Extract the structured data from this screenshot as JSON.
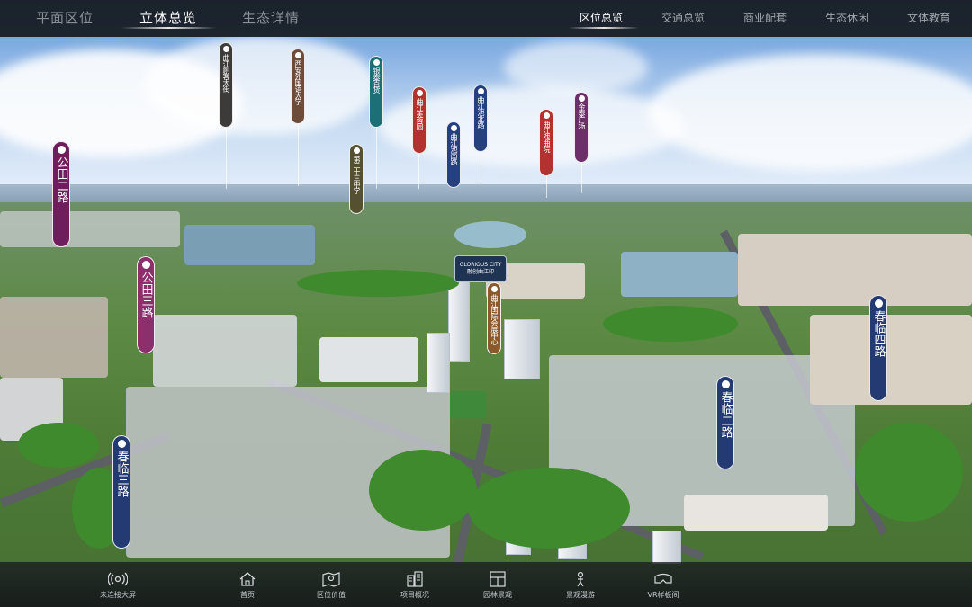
{
  "top_tabs": [
    "平面区位",
    "立体总览",
    "生态详情"
  ],
  "active_top_tab": "立体总览",
  "right_tabs": [
    "区位总览",
    "交通总览",
    "商业配套",
    "生态休闲",
    "文体教育"
  ],
  "active_right_tab": "区位总览",
  "pins_small": [
    {
      "label": "曲江創客大街",
      "color": "#3d3a3a"
    },
    {
      "label": "西安外国语大学",
      "color": "#6e4c3c"
    },
    {
      "label": "银泰百货",
      "color": "#1d6f77"
    },
    {
      "label": "曲江芙蓉园",
      "color": "#b3322f"
    },
    {
      "label": "曲江池北路",
      "color": "#26407e"
    },
    {
      "label": "曲江池南路",
      "color": "#26407e"
    },
    {
      "label": "曲江戏曲院",
      "color": "#b3322f"
    },
    {
      "label": "金泰广场",
      "color": "#6c2f6a"
    },
    {
      "label": "第二十三中学",
      "color": "#55502f"
    },
    {
      "label": "曲江国际会展中心",
      "color": "#8a5a2d"
    }
  ],
  "pins_big": [
    {
      "label": "公田二路",
      "color": "#6e1e5c"
    },
    {
      "label": "公田三路",
      "color": "#8b2f6d"
    },
    {
      "label": "春临三路",
      "color": "#243a73"
    },
    {
      "label": "春临二路",
      "color": "#243a73"
    },
    {
      "label": "春临四路",
      "color": "#243a73"
    }
  ],
  "project_logo": {
    "line1": "GLORIOUS CITY",
    "line2": "融创曲江印"
  },
  "bottom_nav": [
    {
      "label": "未连接大屏",
      "icon": "wireless-cast-icon"
    },
    {
      "label": "首页",
      "icon": "home-icon"
    },
    {
      "label": "区位价值",
      "icon": "map-location-icon"
    },
    {
      "label": "项目概况",
      "icon": "buildings-icon"
    },
    {
      "label": "园林景观",
      "icon": "window-frame-icon"
    },
    {
      "label": "景观漫游",
      "icon": "walking-person-icon"
    },
    {
      "label": "VR样板间",
      "icon": "vr-headset-icon"
    }
  ]
}
